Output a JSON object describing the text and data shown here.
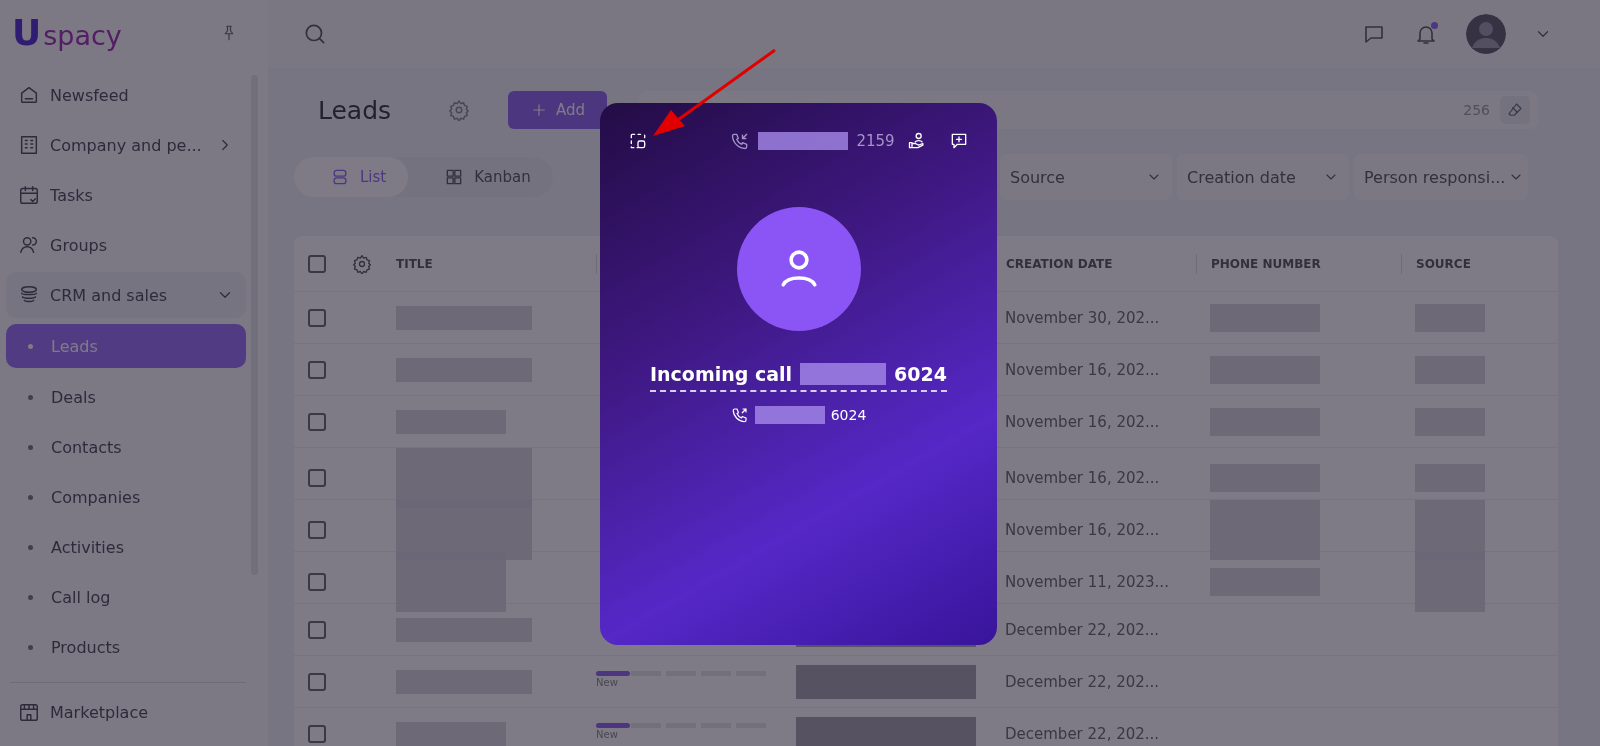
{
  "sidebar": {
    "logo": {
      "mark": "U",
      "text": "spacy"
    },
    "pinned": false,
    "items": [
      {
        "label": "Newsfeed",
        "selected": false
      },
      {
        "label": "Company and pe...",
        "selected": false
      },
      {
        "label": "Tasks",
        "selected": false
      },
      {
        "label": "Groups",
        "selected": false
      },
      {
        "label": "CRM and sales",
        "selected": false,
        "expanded": true,
        "children": [
          {
            "label": "Leads",
            "selected": true
          },
          {
            "label": "Deals",
            "selected": false
          },
          {
            "label": "Contacts",
            "selected": false
          },
          {
            "label": "Companies",
            "selected": false
          },
          {
            "label": "Activities",
            "selected": false
          },
          {
            "label": "Call log",
            "selected": false
          },
          {
            "label": "Products",
            "selected": false
          }
        ]
      },
      {
        "label": "Marketplace",
        "selected": false
      }
    ]
  },
  "topbar": {
    "notifications_unread": true
  },
  "page": {
    "title": "Leads",
    "add_button": "Add",
    "search": {
      "count": "256"
    },
    "views": [
      {
        "label": "List",
        "selected": true
      },
      {
        "label": "Kanban",
        "selected": false
      }
    ],
    "filters": [
      "Source",
      "Creation date",
      "Person responsi..."
    ]
  },
  "table": {
    "all_checked": false,
    "columns": [
      "TITLE",
      "CREATION DATE",
      "PHONE NUMBER",
      "SOURCE"
    ],
    "rows": [
      {
        "checked": false,
        "creation_date": "November 30, 202..."
      },
      {
        "checked": false,
        "creation_date": "November 16, 202..."
      },
      {
        "checked": false,
        "creation_date": "November 16, 202..."
      },
      {
        "checked": false,
        "creation_date": "November 16, 202..."
      },
      {
        "checked": false,
        "creation_date": "November 16, 202..."
      },
      {
        "checked": false,
        "creation_date": "November 11, 2023..."
      },
      {
        "checked": false,
        "creation_date": "December 22, 202..."
      },
      {
        "checked": false,
        "creation_date": "December 22, 202...",
        "stage": {
          "label": "New",
          "level": 0.2
        }
      },
      {
        "checked": false,
        "creation_date": "December 22, 202...",
        "stage": {
          "label": "New",
          "level": 0.2
        }
      }
    ]
  },
  "call_popup": {
    "caller_number": "2159",
    "title": "Incoming call",
    "number": "6024",
    "sub_number": "6024"
  }
}
